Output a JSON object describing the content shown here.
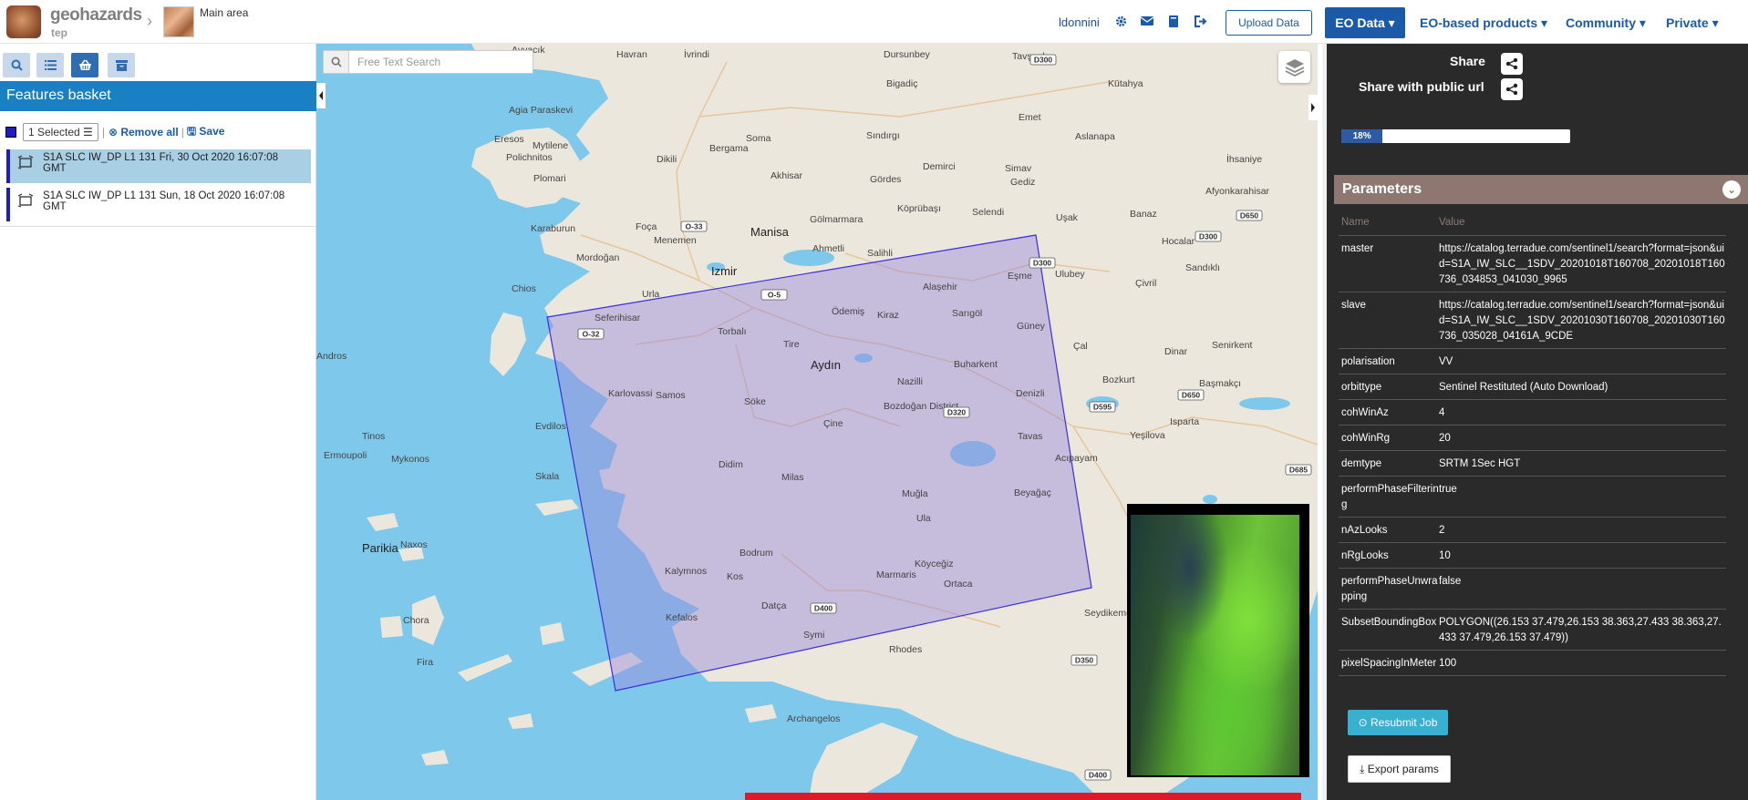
{
  "header": {
    "brand": "geohazards",
    "brand_sub": "tep",
    "breadcrumb_sep": "›",
    "area_label": "Main area",
    "user": "ldonnini",
    "upload_label": "Upload Data",
    "nav": {
      "eo_data": "EO Data ▾",
      "eo_products": "EO-based products ▾",
      "community": "Community ▾",
      "private": "Private ▾"
    }
  },
  "left": {
    "tools": [
      "search-icon",
      "list-icon",
      "basket-icon",
      "archive-icon"
    ],
    "panel_title": "Features basket",
    "selected_label": "1 Selected ☰",
    "remove_all": "Remove all",
    "save": "Save",
    "features": [
      {
        "label": "S1A SLC IW_DP L1 131 Fri, 30 Oct 2020 16:07:08 GMT",
        "selected": true
      },
      {
        "label": "S1A SLC IW_DP L1 131 Sun, 18 Oct 2020 16:07:08 GMT",
        "selected": false
      }
    ]
  },
  "map": {
    "search_placeholder": "Free Text Search",
    "places": [
      {
        "name": "Ayvacık"
      },
      {
        "name": "Havran"
      },
      {
        "name": "İvrindi"
      },
      {
        "name": "Dursunbey"
      },
      {
        "name": "Tavşanlı"
      },
      {
        "name": "Bigadiç"
      },
      {
        "name": "Kütahya"
      },
      {
        "name": "Agia Paraskevi"
      },
      {
        "name": "Eresos"
      },
      {
        "name": "Mytilene"
      },
      {
        "name": "Bergama"
      },
      {
        "name": "Soma"
      },
      {
        "name": "Sındırgı"
      },
      {
        "name": "Emet"
      },
      {
        "name": "Aslanapa"
      },
      {
        "name": "Polichnitos"
      },
      {
        "name": "Dikili"
      },
      {
        "name": "Demirci"
      },
      {
        "name": "Simav"
      },
      {
        "name": "İhsaniye"
      },
      {
        "name": "Plomari"
      },
      {
        "name": "Akhisar"
      },
      {
        "name": "Gördes"
      },
      {
        "name": "Gediz"
      },
      {
        "name": "Afyonkarahisar"
      },
      {
        "name": "Karaburun"
      },
      {
        "name": "Foça"
      },
      {
        "name": "Gölmarmara"
      },
      {
        "name": "Köprübaşı"
      },
      {
        "name": "Selendi"
      },
      {
        "name": "Uşak"
      },
      {
        "name": "Banaz"
      },
      {
        "name": "Menemen"
      },
      {
        "name": "Manisa"
      },
      {
        "name": "Ahmetli"
      },
      {
        "name": "Salihli"
      },
      {
        "name": "Hocalar"
      },
      {
        "name": "Mordoğan"
      },
      {
        "name": "Izmir"
      },
      {
        "name": "Eşme"
      },
      {
        "name": "Ulubey"
      },
      {
        "name": "Sandıklı"
      },
      {
        "name": "Chios"
      },
      {
        "name": "Urla"
      },
      {
        "name": "Alaşehir"
      },
      {
        "name": "Çivril"
      },
      {
        "name": "Seferihisar"
      },
      {
        "name": "Ödemiş"
      },
      {
        "name": "Kiraz"
      },
      {
        "name": "Sarıgöl"
      },
      {
        "name": "Torbalı"
      },
      {
        "name": "Güney"
      },
      {
        "name": "Tire"
      },
      {
        "name": "Çal"
      },
      {
        "name": "Dinar"
      },
      {
        "name": "Senirkent"
      },
      {
        "name": "Buharkent"
      },
      {
        "name": "Nazilli"
      },
      {
        "name": "Başmakçı"
      },
      {
        "name": "Aydın"
      },
      {
        "name": "Bozkurt"
      },
      {
        "name": "Andros"
      },
      {
        "name": "Karlovassi"
      },
      {
        "name": "Samos"
      },
      {
        "name": "Denizli"
      },
      {
        "name": "Isparta"
      },
      {
        "name": "Söke"
      },
      {
        "name": "Bozdoğan District"
      },
      {
        "name": "Evdilos"
      },
      {
        "name": "Çine"
      },
      {
        "name": "Tavas"
      },
      {
        "name": "Yeşilova"
      },
      {
        "name": "Tinos"
      },
      {
        "name": "Ermoupoli"
      },
      {
        "name": "Mykonos"
      },
      {
        "name": "Didim"
      },
      {
        "name": "Acıpayam"
      },
      {
        "name": "Skala"
      },
      {
        "name": "Milas"
      },
      {
        "name": "Muğla"
      },
      {
        "name": "Beyağaç"
      },
      {
        "name": "Parikia"
      },
      {
        "name": "Naxos"
      },
      {
        "name": "Ula"
      },
      {
        "name": "Bodrum"
      },
      {
        "name": "Kalymnos"
      },
      {
        "name": "Kos"
      },
      {
        "name": "Köyceğiz"
      },
      {
        "name": "Marmaris"
      },
      {
        "name": "Ortaca"
      },
      {
        "name": "Chora"
      },
      {
        "name": "Datça"
      },
      {
        "name": "Kefalos"
      },
      {
        "name": "Symi"
      },
      {
        "name": "Seydikemer"
      },
      {
        "name": "Fira"
      },
      {
        "name": "Rhodes"
      },
      {
        "name": "Archangelos"
      }
    ],
    "roads": [
      "O-33",
      "O-5",
      "O-32",
      "D300",
      "D650",
      "D300",
      "D595",
      "D320",
      "D650",
      "D685",
      "D400",
      "D350",
      "D400",
      "D300"
    ]
  },
  "right": {
    "share_label": "Share",
    "share_public_label": "Share with public url",
    "progress_percent": 18,
    "progress_label": "18%",
    "params_title": "Parameters",
    "col_name": "Name",
    "col_value": "Value",
    "params": [
      {
        "name": "master",
        "value": "https://catalog.terradue.com/sentinel1/search?format=json&uid=S1A_IW_SLC__1SDV_20201018T160708_20201018T160736_034853_041030_9965"
      },
      {
        "name": "slave",
        "value": "https://catalog.terradue.com/sentinel1/search?format=json&uid=S1A_IW_SLC__1SDV_20201030T160708_20201030T160736_035028_04161A_9CDE"
      },
      {
        "name": "polarisation",
        "value": "VV"
      },
      {
        "name": "orbittype",
        "value": "Sentinel Restituted (Auto Download)"
      },
      {
        "name": "cohWinAz",
        "value": "4"
      },
      {
        "name": "cohWinRg",
        "value": "20"
      },
      {
        "name": "demtype",
        "value": "SRTM 1Sec HGT"
      },
      {
        "name": "performPhaseFiltering",
        "value": "true"
      },
      {
        "name": "nAzLooks",
        "value": "2"
      },
      {
        "name": "nRgLooks",
        "value": "10"
      },
      {
        "name": "performPhaseUnwrapping",
        "value": "false"
      },
      {
        "name": "SubsetBoundingBox",
        "value": "POLYGON((26.153 37.479,26.153 38.363,27.433 38.363,27.433 37.479,26.153 37.479))"
      },
      {
        "name": "pixelSpacingInMeter",
        "value": "100"
      }
    ],
    "resubmit_label": "Resubmit Job",
    "export_label": "Export params"
  }
}
